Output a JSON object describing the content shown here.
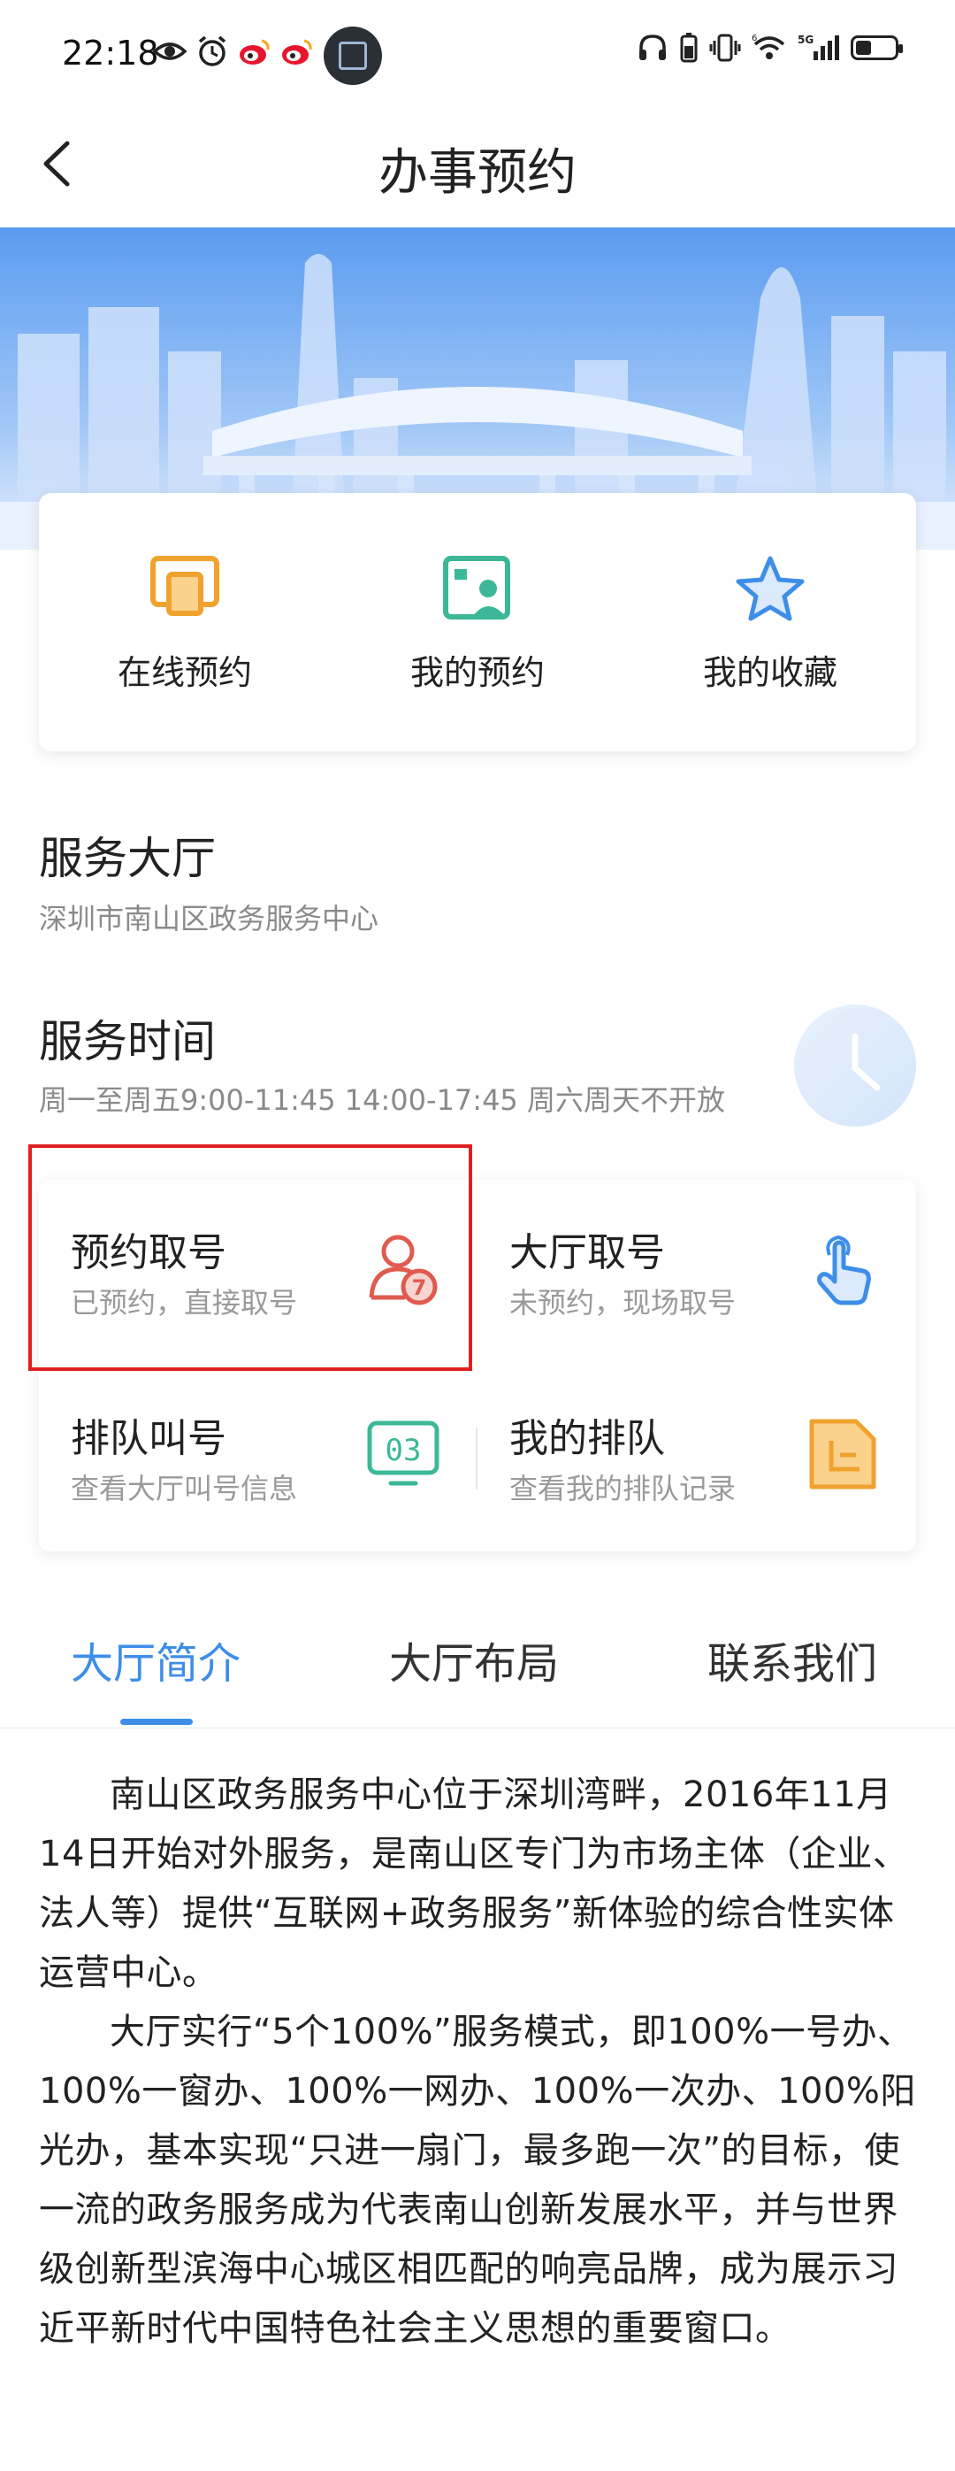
{
  "status_bar": {
    "time": "22:18",
    "left_icons": [
      "eye-icon",
      "alarm-icon",
      "weibo-icon",
      "weibo-icon"
    ],
    "right_icons": [
      "headphones-icon",
      "battery-saver-icon",
      "vibrate-icon",
      "wifi-icon",
      "5g-signal-icon",
      "battery-icon"
    ],
    "signal_label": "5G",
    "wifi_label": "6",
    "battery_level": 0.4
  },
  "header": {
    "title": "办事预约",
    "back_icon": "back-arrow-icon"
  },
  "quick_actions": [
    {
      "label": "在线预约",
      "icon": "online-appointment-icon",
      "color": "#f0a22f"
    },
    {
      "label": "我的预约",
      "icon": "my-appointment-icon",
      "color": "#3cb898"
    },
    {
      "label": "我的收藏",
      "icon": "star-icon",
      "color": "#3e8ee8"
    }
  ],
  "hall": {
    "title": "服务大厅",
    "name": "深圳市南山区政务服务中心"
  },
  "service_time": {
    "title": "服务时间",
    "hours": "周一至周五9:00-11:45 14:00-17:45 周六周天不开放"
  },
  "services": [
    {
      "title": "预约取号",
      "subtitle": "已预约，直接取号",
      "icon": "appointment-ticket-icon",
      "color": "#e05a4f"
    },
    {
      "title": "大厅取号",
      "subtitle": "未预约，现场取号",
      "icon": "tap-hand-icon",
      "color": "#3e8ee8"
    },
    {
      "title": "排队叫号",
      "subtitle": "查看大厅叫号信息",
      "icon": "queue-number-icon",
      "color": "#3cb898",
      "icon_text": "03"
    },
    {
      "title": "我的排队",
      "subtitle": "查看我的排队记录",
      "icon": "queue-record-icon",
      "color": "#f0a22f"
    }
  ],
  "tabs": [
    {
      "label": "大厅简介",
      "active": true
    },
    {
      "label": "大厅布局",
      "active": false
    },
    {
      "label": "联系我们",
      "active": false
    }
  ],
  "colors": {
    "accent": "#3e8ee8",
    "highlight": "#e02020"
  },
  "intro": {
    "paragraphs": [
      "南山区政务服务中心位于深圳湾畔，2016年11月14日开始对外服务，是南山区专门为市场主体（企业、法人等）提供“互联网+政务服务”新体验的综合性实体运营中心。",
      "大厅实行“5个100%”服务模式，即100%一号办、100%一窗办、100%一网办、100%一次办、100%阳光办，基本实现“只进一扇门，最多跑一次”的目标，使一流的政务服务成为代表南山创新发展水平，并与世界级创新型滨海中心城区相匹配的响亮品牌，成为展示习近平新时代中国特色社会主义思想的重要窗口。"
    ]
  }
}
